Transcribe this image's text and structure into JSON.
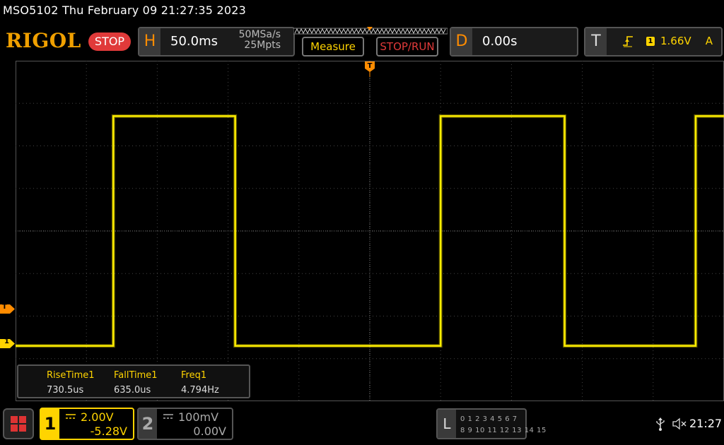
{
  "title_bar": {
    "text": "MSO5102  Thu February 09 21:27:35 2023"
  },
  "brand": {
    "logo": "RIGOL",
    "run_state": "STOP"
  },
  "horizontal": {
    "letter": "H",
    "timebase": "50.0ms",
    "sample_rate": "50MSa/s",
    "memory_depth": "25Mpts"
  },
  "buttons": {
    "measure": "Measure",
    "stop_run": "STOP/RUN"
  },
  "delay": {
    "letter": "D",
    "value": "0.00s"
  },
  "trigger": {
    "letter": "T",
    "source": "1",
    "level": "1.66V",
    "mode": "A"
  },
  "markers": {
    "trigger_top": "T",
    "trigger_level": "T",
    "channel1": "1"
  },
  "measurements": [
    {
      "label": "RiseTime1",
      "value": "730.5us"
    },
    {
      "label": "FallTime1",
      "value": "635.0us"
    },
    {
      "label": "Freq1",
      "value": "4.794Hz"
    }
  ],
  "channel1": {
    "number": "1",
    "scale": "2.00V",
    "offset": "-5.28V"
  },
  "channel2": {
    "number": "2",
    "scale": "100mV",
    "offset": "0.00V"
  },
  "logic": {
    "letter": "L",
    "row1": "0 1 2 3  4 5 6 7",
    "row2": "8 9 10 11 12 13 14 15"
  },
  "status": {
    "clock": "21:27",
    "icons": [
      "usb-icon",
      "speaker-muted-icon"
    ]
  },
  "waveform": {
    "channel": "1",
    "color": "#ffee00",
    "type": "square",
    "high_level_div": 2.7,
    "low_level_div": -2.7,
    "transitions_div": [
      1.38,
      3.1,
      6.0,
      7.75,
      9.6
    ]
  },
  "colors": {
    "ch1": "#ffd400",
    "accent": "#ff8c00",
    "stop": "#e03a3a"
  }
}
